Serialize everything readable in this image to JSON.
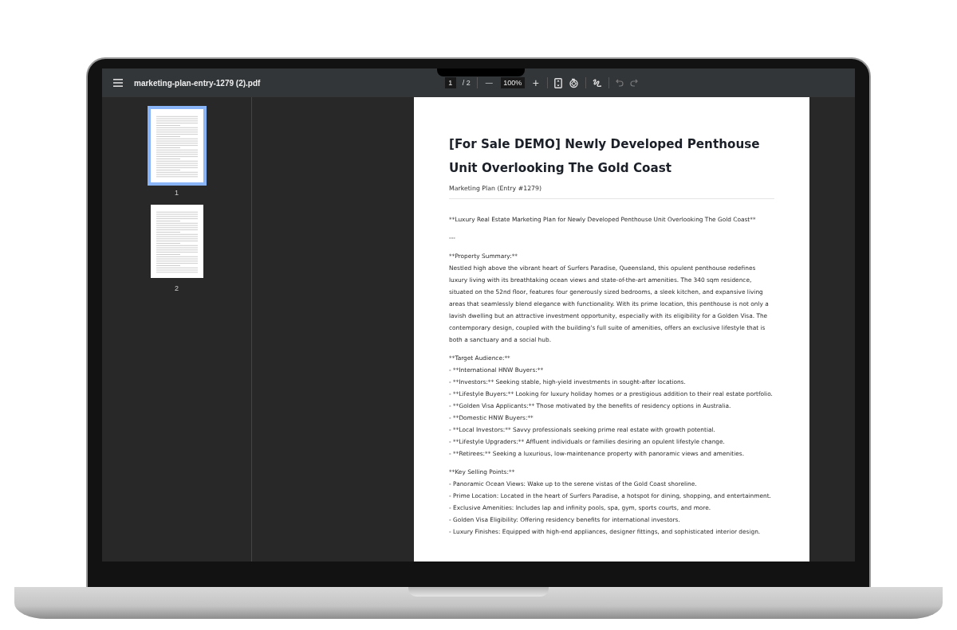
{
  "toolbar": {
    "file_name": "marketing-plan-entry-1279 (2).pdf",
    "page_input": "1",
    "page_count": "/ 2",
    "zoom_out": "—",
    "zoom": "100%",
    "zoom_in": "+"
  },
  "thumbnails": [
    {
      "label": "1",
      "selected": true
    },
    {
      "label": "2",
      "selected": false
    }
  ],
  "document": {
    "title": "[For Sale DEMO] Newly Developed Penthouse Unit Overlooking The Gold Coast",
    "subtitle": "Marketing Plan (Entry #1279)",
    "sections": [
      {
        "lines": [
          "**Luxury Real Estate Marketing Plan for Newly Developed Penthouse Unit Overlooking The Gold Coast**"
        ]
      },
      {
        "lines": [
          "---"
        ]
      },
      {
        "lines": [
          "**Property Summary:**",
          "Nestled high above the vibrant heart of Surfers Paradise, Queensland, this opulent penthouse redefines luxury living with its breathtaking ocean views and state-of-the-art amenities. The 340 sqm residence, situated on the 52nd floor, features four generously sized bedrooms, a sleek kitchen, and expansive living areas that seamlessly blend elegance with functionality. With its prime location, this penthouse is not only a lavish dwelling but an attractive investment opportunity, especially with its eligibility for a Golden Visa. The contemporary design, coupled with the building's full suite of amenities, offers an exclusive lifestyle that is both a sanctuary and a social hub."
        ]
      },
      {
        "lines": [
          "**Target Audience:**",
          "- **International HNW Buyers:**",
          "- **Investors:** Seeking stable, high-yield investments in sought-after locations.",
          "- **Lifestyle Buyers:** Looking for luxury holiday homes or a prestigious addition to their real estate portfolio.",
          "- **Golden Visa Applicants:** Those motivated by the benefits of residency options in Australia.",
          "- **Domestic HNW Buyers:**",
          "- **Local Investors:** Savvy professionals seeking prime real estate with growth potential.",
          "- **Lifestyle Upgraders:** Affluent individuals or families desiring an opulent lifestyle change.",
          "- **Retirees:** Seeking a luxurious, low-maintenance property with panoramic views and amenities."
        ]
      },
      {
        "lines": [
          "**Key Selling Points:**",
          "- Panoramic Ocean Views: Wake up to the serene vistas of the Gold Coast shoreline.",
          "- Prime Location: Located in the heart of Surfers Paradise, a hotspot for dining, shopping, and entertainment.",
          "- Exclusive Amenities: Includes lap and infinity pools, spa, gym, sports courts, and more.",
          "- Golden Visa Eligibility: Offering residency benefits for international investors.",
          "- Luxury Finishes: Equipped with high-end appliances, designer fittings, and sophisticated interior design."
        ]
      }
    ]
  }
}
